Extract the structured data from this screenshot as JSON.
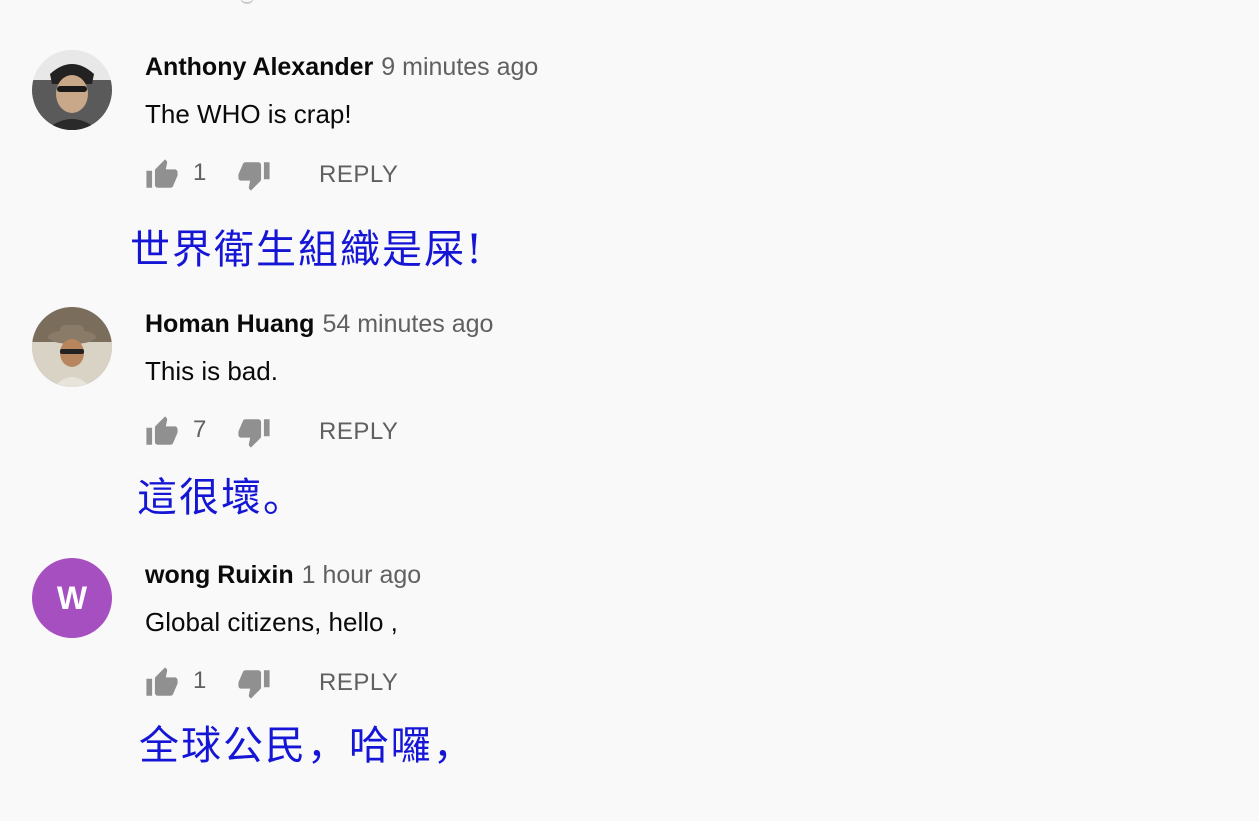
{
  "comments": [
    {
      "author": "Anthony Alexander",
      "time": "9 minutes ago",
      "text": "The WHO is crap!",
      "likes": "1",
      "reply_label": "REPLY",
      "avatar_type": "photo",
      "translation": "世界衛生組織是屎!"
    },
    {
      "author": "Homan Huang",
      "time": "54 minutes ago",
      "text": "This is bad.",
      "likes": "7",
      "reply_label": "REPLY",
      "avatar_type": "photo",
      "translation": "這很壞。"
    },
    {
      "author": "wong Ruixin",
      "time": "1 hour ago",
      "text": "Global citizens, hello ,",
      "likes": "1",
      "reply_label": "REPLY",
      "avatar_type": "letter",
      "avatar_letter": "W",
      "avatar_color": "#a64fc0",
      "translation": "全球公民，哈囉，"
    }
  ],
  "colors": {
    "background": "#f9f9f9",
    "author": "#0a0a0a",
    "meta": "#606060",
    "icon": "#909090",
    "translation": "#1515d6"
  },
  "icons": {
    "like": "thumbs-up-icon",
    "dislike": "thumbs-down-icon"
  }
}
